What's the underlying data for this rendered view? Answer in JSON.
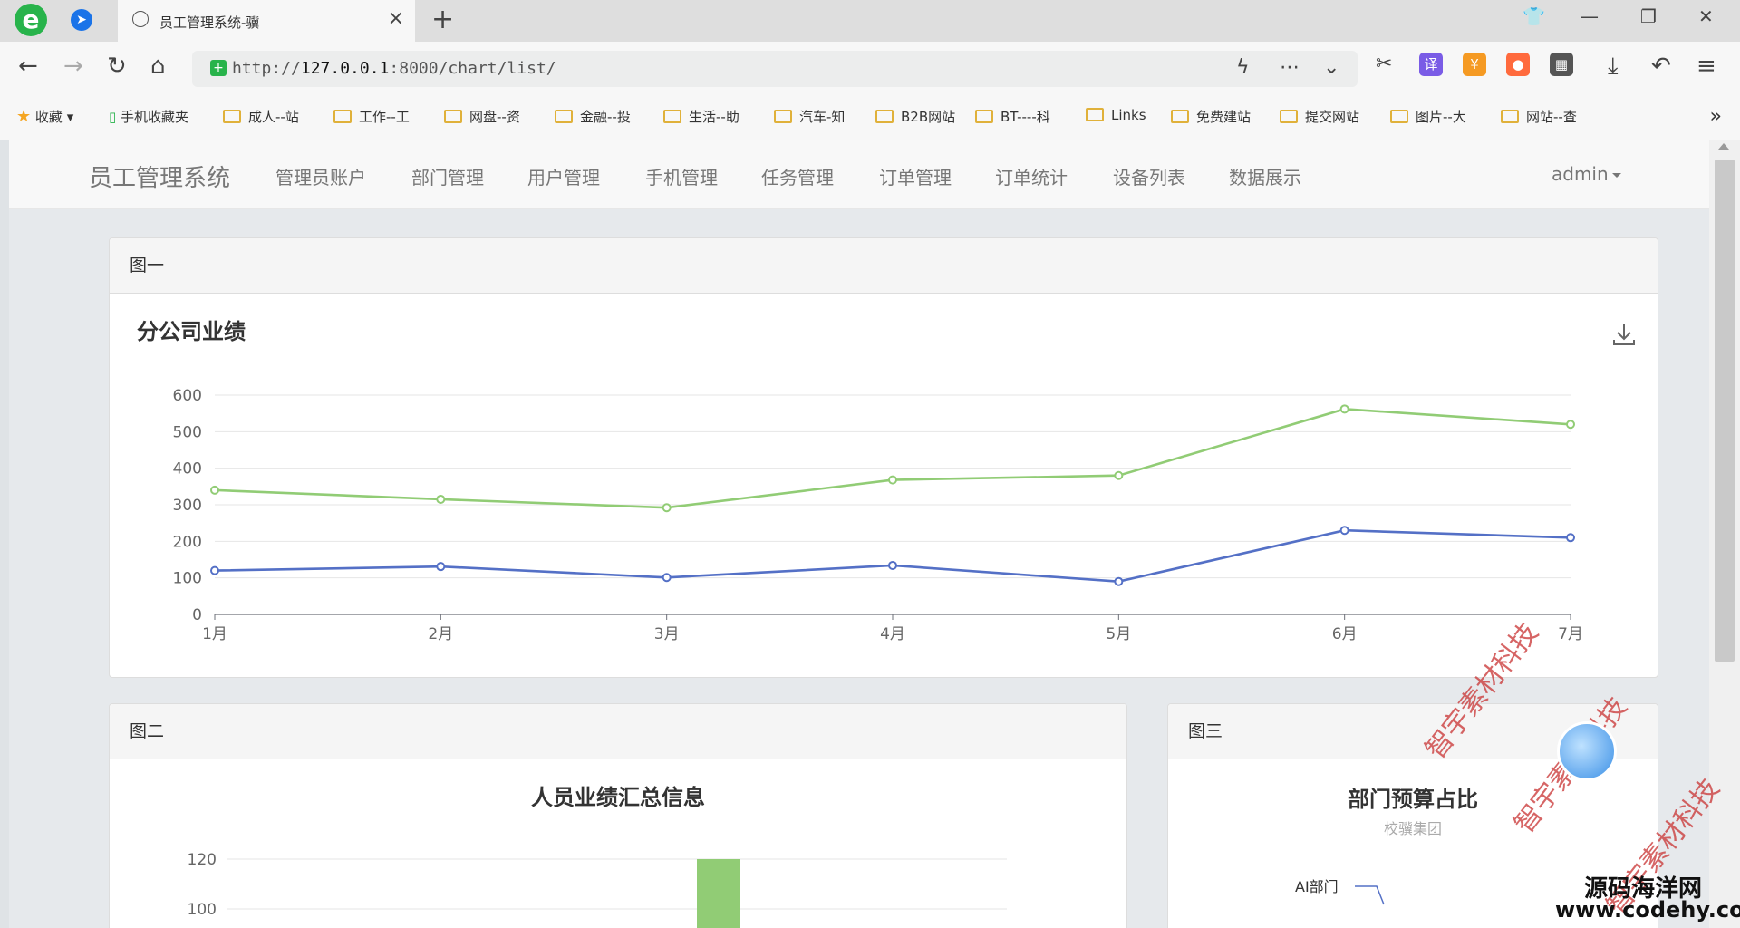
{
  "browser": {
    "tab_title": "员工管理系统-骥",
    "tab_close": "×",
    "new_tab": "+",
    "url_host": "127.0.0.1",
    "url_scheme": "http://",
    "url_path": ":8000/chart/list/",
    "bookmarks_label": "收藏",
    "bookmarks": [
      "手机收藏夹",
      "成人--站",
      "工作--工",
      "网盘--资",
      "金融--投",
      "生活--助",
      "汽车-知",
      "B2B网站",
      "BT----科",
      "Links",
      "免费建站",
      "提交网站",
      "图片--大",
      "网站--查"
    ]
  },
  "app": {
    "brand": "员工管理系统",
    "menu": [
      "管理员账户",
      "部门管理",
      "用户管理",
      "手机管理",
      "任务管理",
      "订单管理",
      "订单统计",
      "设备列表",
      "数据展示"
    ],
    "user": "admin"
  },
  "panels": {
    "one": {
      "heading": "图一"
    },
    "two": {
      "heading": "图二"
    },
    "three": {
      "heading": "图三"
    }
  },
  "chart_data": [
    {
      "type": "line",
      "title": "分公司业绩",
      "categories": [
        "1月",
        "2月",
        "3月",
        "4月",
        "5月",
        "6月",
        "7月"
      ],
      "ylim": [
        0,
        600
      ],
      "yticks": [
        0,
        100,
        200,
        300,
        400,
        500,
        600
      ],
      "grid": true,
      "series": [
        {
          "values": [
            340,
            315,
            292,
            368,
            380,
            562,
            520
          ],
          "color": "#91cc75"
        },
        {
          "values": [
            120,
            131,
            101,
            134,
            90,
            230,
            210
          ],
          "color": "#5470c6"
        }
      ]
    },
    {
      "type": "bar",
      "title": "人员业绩汇总信息",
      "yticks_visible": [
        100,
        120
      ],
      "series": [
        {
          "values": [
            120
          ],
          "color": "#91cc75"
        }
      ]
    },
    {
      "type": "pie",
      "title": "部门预算占比",
      "subtitle": "校骥集团",
      "categories": [
        "AI部门"
      ]
    }
  ],
  "overlay": {
    "watermark": "智宇素材科技",
    "site_name": "源码海洋网",
    "site_url": "www.codehy.com"
  }
}
